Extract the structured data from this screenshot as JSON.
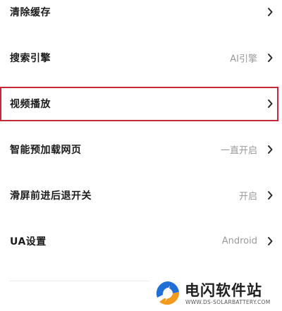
{
  "settings": {
    "items": [
      {
        "label": "清除缓存",
        "value": ""
      },
      {
        "label": "搜索引擎",
        "value": "AI引擎"
      },
      {
        "label": "视频播放",
        "value": ""
      },
      {
        "label": "智能预加载网页",
        "value": "一直开启"
      },
      {
        "label": "滑屏前进后退开关",
        "value": "开启"
      },
      {
        "label": "UA设置",
        "value": "Android"
      }
    ]
  },
  "highlight": {
    "color": "#c22a37",
    "target": "视频播放"
  },
  "watermark": {
    "title": "电闪软件站",
    "subtitle": "WWW.DS-SOLARBATTERY.COM",
    "logo": "lightning-logo",
    "colors": {
      "blue": "#1f6fd6",
      "orange": "#f29a1c"
    }
  },
  "icons": {
    "row_arrow": "chevron-right-icon"
  }
}
